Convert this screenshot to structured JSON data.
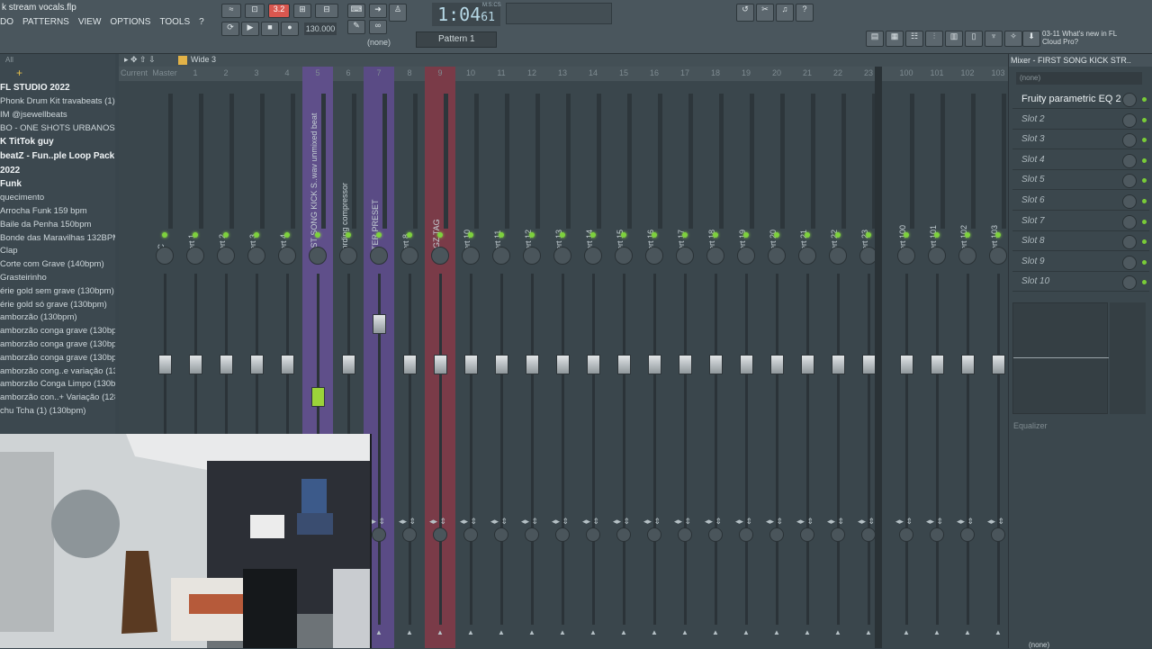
{
  "window": {
    "title": "k stream vocals.flp"
  },
  "menu": [
    "DO",
    "PATTERNS",
    "VIEW",
    "OPTIONS",
    "TOOLS",
    "?"
  ],
  "transport": {
    "time_main": "1:04",
    "time_sub": "61",
    "time_unit": "M:S:CS",
    "tempo": "130.000",
    "pattern": "Pattern 1",
    "snap": "(none)",
    "beat_counter": "3.2"
  },
  "news": {
    "date": "03-11",
    "text": "What's new in FL Cloud Pro?"
  },
  "browser": {
    "header": "All",
    "items": [
      {
        "label": "FL STUDIO 2022",
        "type": "folder"
      },
      {
        "label": "Phonk Drum Kit travabeats (1)",
        "type": "item"
      },
      {
        "label": "IM @jsewellbeats",
        "type": "item"
      },
      {
        "label": "BO - ONE SHOTS URBANOS VOL. 2",
        "type": "item"
      },
      {
        "label": "K TitTok guy",
        "type": "folder"
      },
      {
        "label": "beatZ - Fun..ple Loop Pack 2022",
        "type": "folder"
      },
      {
        "label": "",
        "type": "gap"
      },
      {
        "label": "Funk",
        "type": "folder"
      },
      {
        "label": "quecimento",
        "type": "item"
      },
      {
        "label": "Arrocha Funk 159 bpm",
        "type": "item"
      },
      {
        "label": "Baile da Penha 150bpm",
        "type": "item"
      },
      {
        "label": "Bonde das Maravilhas 132BPM",
        "type": "item"
      },
      {
        "label": "Clap",
        "type": "item"
      },
      {
        "label": "Corte com Grave (140bpm)",
        "type": "item"
      },
      {
        "label": "Grasteirinho",
        "type": "item"
      },
      {
        "label": "érie gold sem grave (130bpm)",
        "type": "item"
      },
      {
        "label": "érie gold só grave (130bpm)",
        "type": "item"
      },
      {
        "label": "amborzão (130bpm)",
        "type": "item"
      },
      {
        "label": "amborzão conga grave (130bpm) (1)",
        "type": "item"
      },
      {
        "label": "amborzão conga grave (130bpm) (2)",
        "type": "item"
      },
      {
        "label": "amborzão conga grave (130bpm) (3)",
        "type": "item"
      },
      {
        "label": "amborzão cong..e variação (130bpm)",
        "type": "item"
      },
      {
        "label": "amborzão Conga Limpo (130bpm)",
        "type": "item"
      },
      {
        "label": "amborzão con..+ Variação (128bpm)",
        "type": "item"
      },
      {
        "label": "chu Tcha (1) (130bpm)",
        "type": "item"
      }
    ]
  },
  "mixer": {
    "toolbar_label": "Wide 3",
    "tracks": [
      {
        "num": "Current",
        "name": "",
        "color": "none",
        "fader": 0.0
      },
      {
        "num": "Master",
        "name": "REC",
        "color": "none",
        "fader": 0.7
      },
      {
        "num": "1",
        "name": "Insert 1",
        "color": "none",
        "fader": 0.7
      },
      {
        "num": "2",
        "name": "Insert 2",
        "color": "none",
        "fader": 0.7
      },
      {
        "num": "3",
        "name": "Insert 3",
        "color": "none",
        "fader": 0.7
      },
      {
        "num": "4",
        "name": "Insert 4",
        "color": "none",
        "fader": 0.7
      },
      {
        "num": "5",
        "name": "FIRST SONG KICK S..wav unmixed beat",
        "color": "#5f4f8a",
        "fader": 0.58
      },
      {
        "num": "6",
        "name": "recording compressor",
        "color": "none",
        "fader": 0.7
      },
      {
        "num": "7",
        "name": "PETER PRESET",
        "color": "#5a4b85",
        "fader": 0.85
      },
      {
        "num": "8",
        "name": "Insert 8",
        "color": "none",
        "fader": 0.7
      },
      {
        "num": "9",
        "name": "TIAGZ TAG",
        "color": "#7a3b48",
        "fader": 0.7
      },
      {
        "num": "10",
        "name": "Insert 10",
        "color": "none",
        "fader": 0.7
      },
      {
        "num": "11",
        "name": "Insert 11",
        "color": "none",
        "fader": 0.7
      },
      {
        "num": "12",
        "name": "Insert 12",
        "color": "none",
        "fader": 0.7
      },
      {
        "num": "13",
        "name": "Insert 13",
        "color": "none",
        "fader": 0.7
      },
      {
        "num": "14",
        "name": "Insert 14",
        "color": "none",
        "fader": 0.7
      },
      {
        "num": "15",
        "name": "Insert 15",
        "color": "none",
        "fader": 0.7
      },
      {
        "num": "16",
        "name": "Insert 16",
        "color": "none",
        "fader": 0.7
      },
      {
        "num": "17",
        "name": "Insert 17",
        "color": "none",
        "fader": 0.7
      },
      {
        "num": "18",
        "name": "Insert 18",
        "color": "none",
        "fader": 0.7
      },
      {
        "num": "19",
        "name": "Insert 19",
        "color": "none",
        "fader": 0.7
      },
      {
        "num": "20",
        "name": "Insert 20",
        "color": "none",
        "fader": 0.7
      },
      {
        "num": "21",
        "name": "Insert 21",
        "color": "none",
        "fader": 0.7
      },
      {
        "num": "22",
        "name": "Insert 22",
        "color": "none",
        "fader": 0.7
      },
      {
        "num": "23",
        "name": "Insert 23",
        "color": "none",
        "fader": 0.7
      },
      {
        "num": "100",
        "name": "Insert 100",
        "color": "none",
        "fader": 0.7
      },
      {
        "num": "101",
        "name": "Insert 101",
        "color": "none",
        "fader": 0.7
      },
      {
        "num": "102",
        "name": "Insert 102",
        "color": "none",
        "fader": 0.7
      },
      {
        "num": "103",
        "name": "Insert 103",
        "color": "none",
        "fader": 0.7
      }
    ]
  },
  "mixer_panel": {
    "title": "Mixer - FIRST SONG KICK STR..",
    "input": "(none)",
    "output": "(none)",
    "slots": [
      "Fruity parametric EQ 2",
      "Slot 2",
      "Slot 3",
      "Slot 4",
      "Slot 5",
      "Slot 6",
      "Slot 7",
      "Slot 8",
      "Slot 9",
      "Slot 10"
    ],
    "eq_label": "Equalizer"
  },
  "colors": {
    "accent_green": "#7ed13d",
    "selected_fader": "#9bd33a"
  }
}
